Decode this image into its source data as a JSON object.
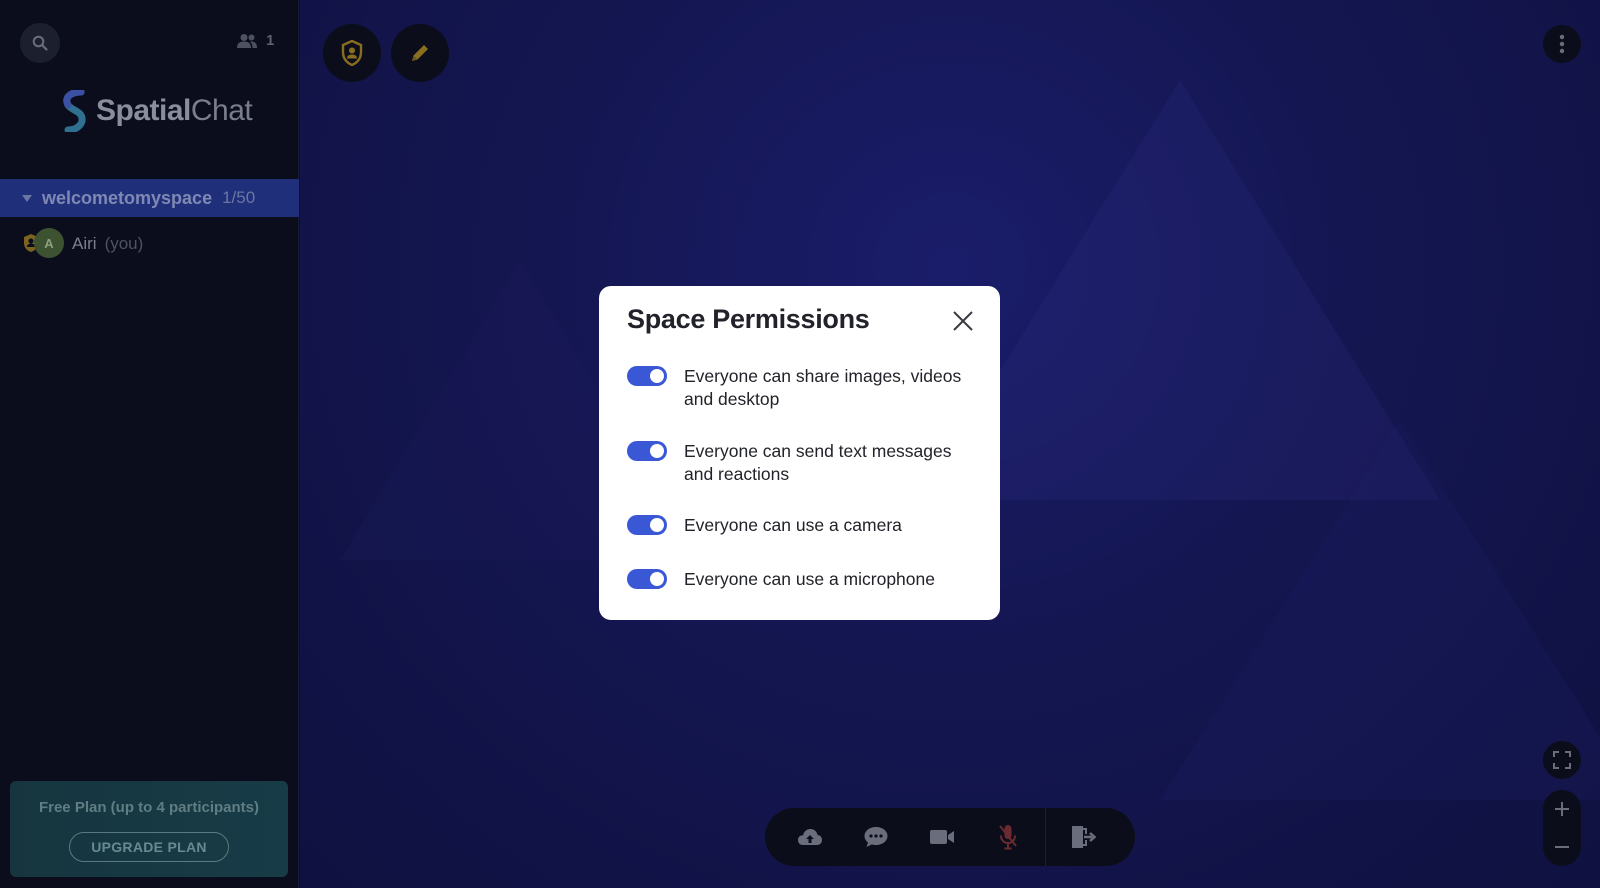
{
  "sidebar": {
    "participant_count": "1",
    "logo": {
      "bold": "Spatial",
      "light": "Chat"
    },
    "room": {
      "name": "welcometomyspace",
      "count": "1/50"
    },
    "users": [
      {
        "initial": "A",
        "name": "Airi",
        "suffix": "(you)"
      }
    ],
    "plan": {
      "text": "Free Plan (up to 4 participants)",
      "upgrade_label": "UPGRADE PLAN"
    }
  },
  "toolbar": {
    "icons": [
      "host-shield-icon",
      "pencil-icon",
      "more-vertical-icon"
    ]
  },
  "bottom_bar": {
    "icons": [
      "share-upload-icon",
      "chat-icon",
      "camera-icon",
      "mic-muted-icon",
      "leave-icon"
    ]
  },
  "modal": {
    "title": "Space Permissions",
    "permissions": [
      {
        "label": "Everyone can share images, videos and desktop",
        "enabled": true
      },
      {
        "label": "Everyone can send text messages and reactions",
        "enabled": true
      },
      {
        "label": "Everyone can use a camera",
        "enabled": true
      },
      {
        "label": "Everyone can use a microphone",
        "enabled": true
      }
    ]
  },
  "colors": {
    "accent": "#3a57d6",
    "room_highlight": "#1f2f7a",
    "canvas": "#141651",
    "host_gold": "#b08a28"
  }
}
